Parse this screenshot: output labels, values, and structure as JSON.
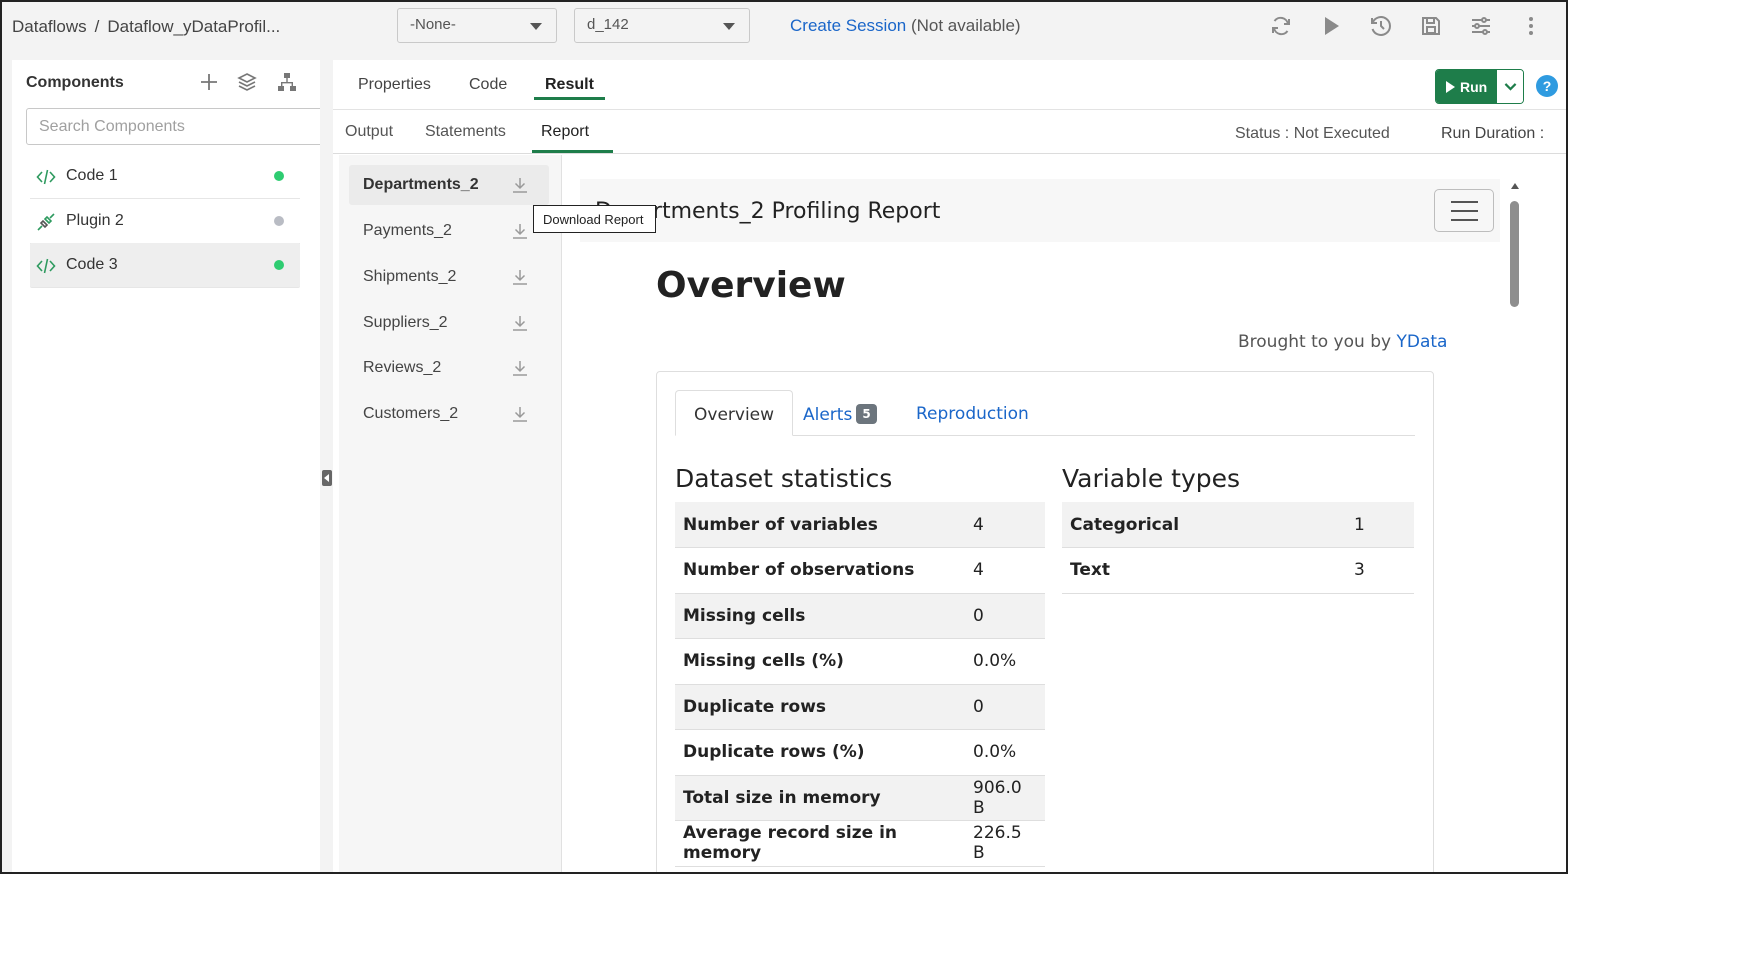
{
  "topbar": {
    "breadcrumb": [
      "Dataflows",
      "Dataflow_yDataProfil..."
    ],
    "breadcrumb_sep": "/",
    "select_1": "-None-",
    "select_2": "d_142",
    "session_link": "Create Session",
    "session_status": "(Not available)",
    "icons": [
      "refresh-icon",
      "play-icon",
      "history-icon",
      "save-icon",
      "settings-sliders-icon",
      "more-vertical-icon"
    ]
  },
  "sidebar": {
    "title": "Components",
    "search_placeholder": "Search Components",
    "items": [
      {
        "label": "Code 1",
        "icon": "code-icon",
        "status_color": "#2ecc71"
      },
      {
        "label": "Plugin 2",
        "icon": "plugin-icon",
        "status_color": "#b9bcc4"
      },
      {
        "label": "Code 3",
        "icon": "code-icon",
        "status_color": "#2ecc71"
      }
    ]
  },
  "main": {
    "tabs": [
      "Properties",
      "Code",
      "Result"
    ],
    "active_tab": "Result",
    "run_label": "Run",
    "help_label": "?",
    "subtabs": [
      "Output",
      "Statements",
      "Report"
    ],
    "active_subtab": "Report",
    "status": "Status : Not Executed",
    "run_duration": "Run Duration :"
  },
  "reports": {
    "items": [
      "Departments_2",
      "Payments_2",
      "Shipments_2",
      "Suppliers_2",
      "Reviews_2",
      "Customers_2"
    ],
    "active": "Departments_2",
    "tooltip": "Download Report"
  },
  "report": {
    "header_title": "Departments_2 Profiling Report",
    "overview_title": "Overview",
    "brought_prefix": "Brought to you by",
    "brought_link": "YData",
    "tabs": {
      "overview": "Overview",
      "alerts": "Alerts",
      "alerts_count": "5",
      "reproduction": "Reproduction"
    },
    "dataset_statistics": {
      "title": "Dataset statistics",
      "rows": [
        {
          "key": "Number of variables",
          "value": "4"
        },
        {
          "key": "Number of observations",
          "value": "4"
        },
        {
          "key": "Missing cells",
          "value": "0"
        },
        {
          "key": "Missing cells (%)",
          "value": "0.0%"
        },
        {
          "key": "Duplicate rows",
          "value": "0"
        },
        {
          "key": "Duplicate rows (%)",
          "value": "0.0%"
        },
        {
          "key": "Total size in memory",
          "value": "906.0 B"
        },
        {
          "key": "Average record size in memory",
          "value": "226.5 B"
        }
      ]
    },
    "variable_types": {
      "title": "Variable types",
      "rows": [
        {
          "key": "Categorical",
          "value": "1"
        },
        {
          "key": "Text",
          "value": "3"
        }
      ]
    }
  },
  "colors": {
    "accent": "#1e7d4a",
    "link": "#1a66c9",
    "status_active": "#2ecc71",
    "status_inactive": "#b9bcc4"
  }
}
